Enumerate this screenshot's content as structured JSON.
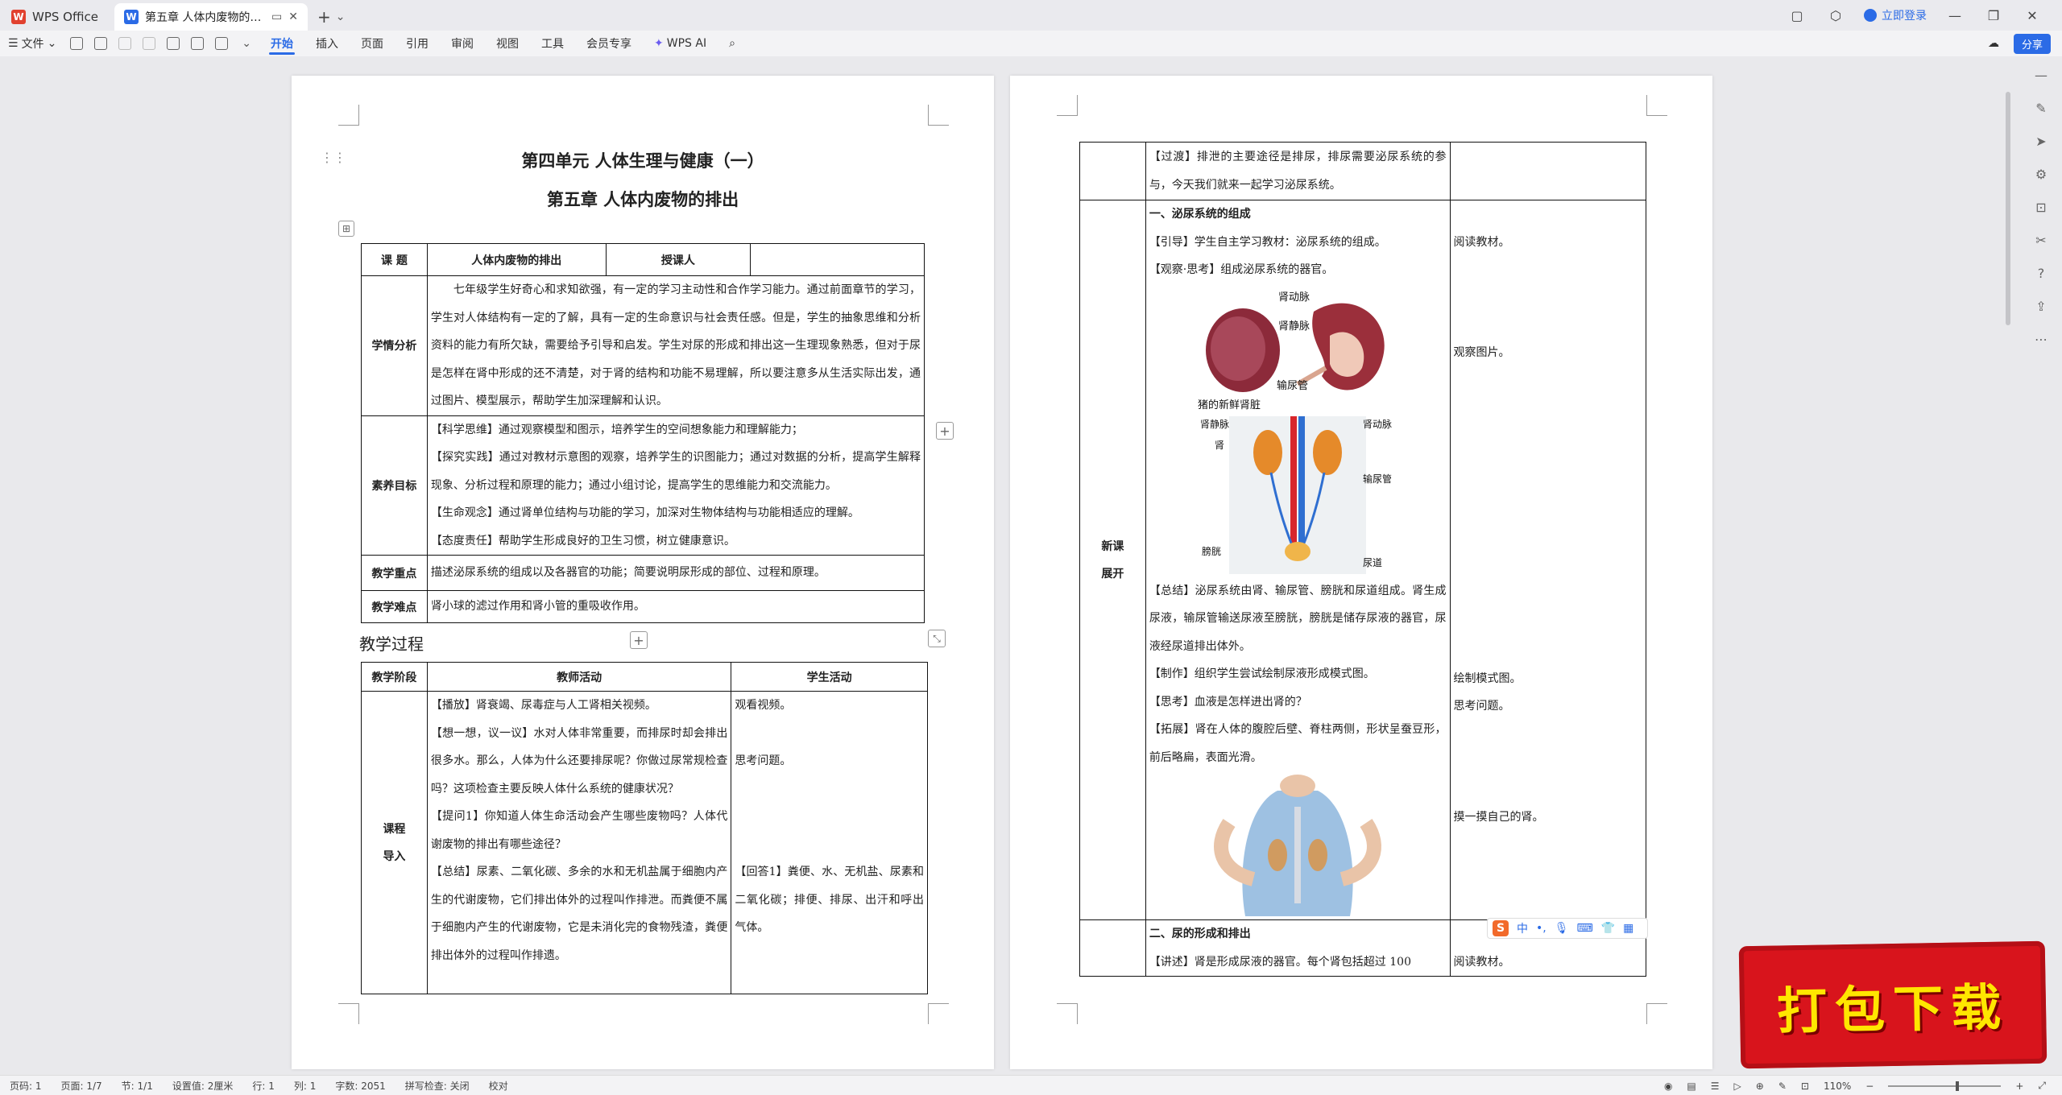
{
  "titlebar": {
    "app_name": "WPS Office",
    "doc_tab_title": "第五章  人体内废物的排出.do",
    "login": "立即登录"
  },
  "ribbon": {
    "file_menu": "文件",
    "tabs": [
      "开始",
      "插入",
      "页面",
      "引用",
      "审阅",
      "视图",
      "工具",
      "会员专享"
    ],
    "ai": "WPS AI",
    "share": "分享"
  },
  "page1": {
    "title": "第四单元   人体生理与健康（一）",
    "subtitle": "第五章   人体内废物的排出",
    "info_table": {
      "label_topic": "课      题",
      "topic": "人体内废物的排出",
      "label_teacher": "授课人",
      "teacher": "",
      "label_analysis": "学情分析",
      "analysis": "七年级学生好奇心和求知欲强，有一定的学习主动性和合作学习能力。通过前面章节的学习，学生对人体结构有一定的了解，具有一定的生命意识与社会责任感。但是，学生的抽象思维和分析资料的能力有所欠缺，需要给予引导和启发。学生对尿的形成和排出这一生理现象熟悉，但对于尿是怎样在肾中形成的还不清楚，对于肾的结构和功能不易理解，所以要注意多从生活实际出发，通过图片、模型展示，帮助学生加深理解和认识。",
      "label_goals": "素养目标",
      "goals": [
        "【科学思维】通过观察模型和图示，培养学生的空间想象能力和理解能力；",
        "【探究实践】通过对教材示意图的观察，培养学生的识图能力；通过对数据的分析，提高学生解释现象、分析过程和原理的能力；通过小组讨论，提高学生的思维能力和交流能力。",
        "【生命观念】通过肾单位结构与功能的学习，加深对生物体结构与功能相适应的理解。",
        "【态度责任】帮助学生形成良好的卫生习惯，树立健康意识。"
      ],
      "label_key": "教学重点",
      "key": "描述泌尿系统的组成以及各器官的功能；简要说明尿形成的部位、过程和原理。",
      "label_difficult": "教学难点",
      "difficult": "肾小球的滤过作用和肾小管的重吸收作用。"
    },
    "process_title": "教学过程",
    "process_table": {
      "headers": [
        "教学阶段",
        "教师活动",
        "学生活动"
      ],
      "stage": "课程\n导入",
      "teacher": [
        "【播放】肾衰竭、尿毒症与人工肾相关视频。",
        "【想一想，议一议】水对人体非常重要，而排尿时却会排出很多水。那么，人体为什么还要排尿呢？你做过尿常规检查吗？这项检查主要反映人体什么系统的健康状况？",
        "【提问1】你知道人体生命活动会产生哪些废物吗？人体代谢废物的排出有哪些途径？",
        "【总结】尿素、二氧化碳、多余的水和无机盐属于细胞内产生的代谢废物，它们排出体外的过程叫作排泄。而粪便不属于细胞内产生的代谢废物，它是未消化完的食物残渣，粪便排出体外的过程叫作排遗。"
      ],
      "student": [
        "观看视频。",
        "",
        "思考问题。",
        "",
        "",
        "",
        "【回答1】粪便、水、无机盐、尿素和二氧化碳；排便、排尿、出汗和呼出气体。"
      ]
    }
  },
  "page2": {
    "row1_teacher": "【过渡】排泄的主要途径是排尿，排尿需要泌尿系统的参与，今天我们就来一起学习泌尿系统。",
    "stage": "新课\n展开",
    "section1": "一、泌尿系统的组成",
    "guide": "【引导】学生自主学习教材：泌尿系统的组成。",
    "observe": "【观察·思考】组成泌尿系统的器官。",
    "kidney_labels": {
      "artery": "肾动脉",
      "vein": "肾静脉",
      "pig": "猪的新鲜肾脏",
      "ureter": "输尿管"
    },
    "system_labels": {
      "vein": "肾静脉",
      "artery": "肾动脉",
      "kidney": "肾",
      "ureter": "输尿管",
      "bladder": "膀胱",
      "urethra": "尿道"
    },
    "summary": "【总结】泌尿系统由肾、输尿管、膀胱和尿道组成。肾生成尿液，输尿管输送尿液至膀胱，膀胱是储存尿液的器官，尿液经尿道排出体外。",
    "make": "【制作】组织学生尝试绘制尿液形成模式图。",
    "think": "【思考】血液是怎样进出肾的？",
    "extend": "【拓展】肾在人体的腹腔后壁、脊柱两侧，形状呈蚕豆形，前后略扁，表面光滑。",
    "section2": "二、尿的形成和排出",
    "lecture": "【讲述】肾是形成尿液的器官。每个肾包括超过 100",
    "student": {
      "read": "阅读教材。",
      "observe": "观察图片。",
      "draw": "绘制模式图。",
      "think": "思考问题。",
      "touch": "摸一摸自己的肾。",
      "read2": "阅读教材。"
    }
  },
  "ime": {
    "label": "中"
  },
  "download_badge": "打包下载",
  "statusbar": {
    "page": "页码: 1",
    "pages": "页面: 1/7",
    "section": "节: 1/1",
    "setting": "设置值: 2厘米",
    "row": "行: 1",
    "col": "列: 1",
    "words": "字数: 2051",
    "spell": "拼写检查: 关闭",
    "proof": "校对",
    "zoom": "110%"
  }
}
